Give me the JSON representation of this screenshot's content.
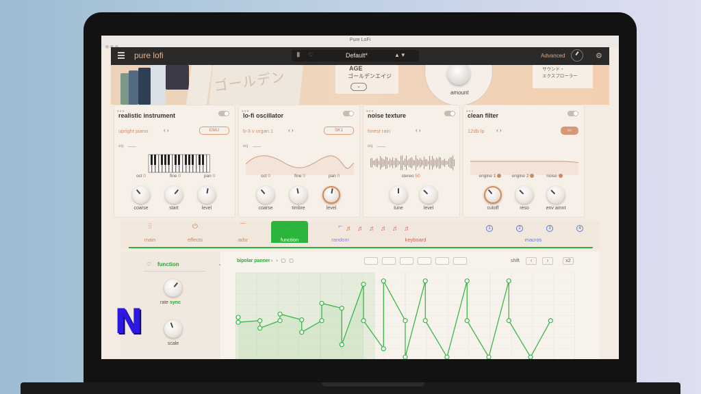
{
  "window": {
    "title": "Pure LoFi"
  },
  "header": {
    "brand": "pure lofi",
    "preset_name": "Default*",
    "preset_arrows": "▲▼",
    "mode": "Advanced",
    "icons": [
      "menu-icon",
      "library-icon",
      "heart-icon",
      "settings-icon"
    ]
  },
  "banner": {
    "age_title": "AGE",
    "age_subtitle": "ゴールデンエイジ",
    "amount_label": "amount",
    "sound_line1": "サウンド・",
    "sound_line2": "エクスプローラー",
    "jp_art": "ゴールデン"
  },
  "modules": [
    {
      "title": "realistic instrument",
      "source": "upright piano",
      "tag": "EMU",
      "eq_label": "eq",
      "params": [
        {
          "label": "oct",
          "value": "0"
        },
        {
          "label": "fine",
          "value": "0"
        },
        {
          "label": "pan",
          "value": "0"
        }
      ],
      "knobs": [
        "coarse",
        "start",
        "level"
      ]
    },
    {
      "title": "lo-fi oscillator",
      "source": "b-3 v organ 1",
      "tag": "SK1",
      "eq_label": "eq",
      "params": [
        {
          "label": "oct",
          "value": "0"
        },
        {
          "label": "fine",
          "value": "0"
        },
        {
          "label": "pan",
          "value": "0"
        }
      ],
      "knobs": [
        "coarse",
        "timbre",
        "level"
      ]
    },
    {
      "title": "noise texture",
      "source": "forest rain",
      "eq_label": "eq",
      "params": [
        {
          "label": "stereo",
          "value": "50"
        }
      ],
      "knobs": [
        "tune",
        "level"
      ]
    },
    {
      "title": "clean filter",
      "source": "12db lp",
      "params": [
        {
          "label": "engine 1"
        },
        {
          "label": "engine 2"
        },
        {
          "label": "noise"
        }
      ],
      "knobs": [
        "cutoff",
        "reso",
        "env amnt"
      ]
    }
  ],
  "nav_tabs": [
    {
      "label": "main",
      "icon": "mixer-icon"
    },
    {
      "label": "effects",
      "icon": "power-icon"
    },
    {
      "label": "adsr",
      "icon": "envelope-icon"
    },
    {
      "label": "function",
      "icon": "function-icon",
      "active": true
    },
    {
      "label": "random",
      "icon": "random-icon"
    },
    {
      "label": "keyboard",
      "icon": "keyboard-icon"
    },
    {
      "label": "macros",
      "icon": "macro-icon"
    }
  ],
  "macros": [
    "1",
    "2",
    "3",
    "4"
  ],
  "function_panel": {
    "heart": "♡",
    "title": "function",
    "rate_label": "rate",
    "sync_label": "sync",
    "scale_label": "scale",
    "lfo_preset": "bipolar panner",
    "shift_label": "shift",
    "multiplier": "x2",
    "prev": "‹",
    "next": "›"
  },
  "lfo_points": [
    [
      0.0,
      0.52
    ],
    [
      0.0,
      0.58
    ],
    [
      0.065,
      0.56
    ],
    [
      0.065,
      0.65
    ],
    [
      0.125,
      0.56
    ],
    [
      0.125,
      0.48
    ],
    [
      0.19,
      0.55
    ],
    [
      0.19,
      0.7
    ],
    [
      0.25,
      0.56
    ],
    [
      0.25,
      0.35
    ],
    [
      0.31,
      0.41
    ],
    [
      0.31,
      0.85
    ],
    [
      0.375,
      0.12
    ],
    [
      0.375,
      0.56
    ],
    [
      0.435,
      0.9
    ],
    [
      0.435,
      0.08
    ],
    [
      0.5,
      0.56
    ],
    [
      0.5,
      1.0
    ],
    [
      0.56,
      0.08
    ],
    [
      0.56,
      0.56
    ],
    [
      0.625,
      1.0
    ],
    [
      0.685,
      0.08
    ],
    [
      0.685,
      0.56
    ],
    [
      0.75,
      1.0
    ],
    [
      0.81,
      0.08
    ],
    [
      0.81,
      0.56
    ],
    [
      0.875,
      1.0
    ],
    [
      0.935,
      0.56
    ]
  ],
  "colors": {
    "accent": "#2bb53c",
    "brand": "#e2b28e",
    "orange": "#d17d4f"
  }
}
